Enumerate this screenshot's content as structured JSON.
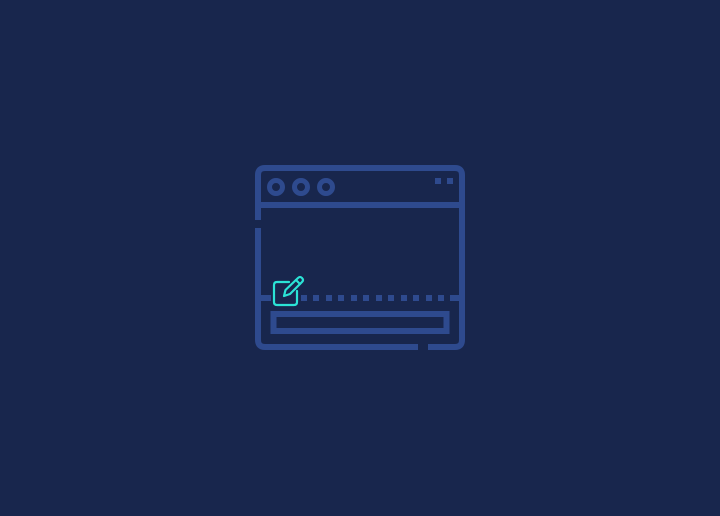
{
  "colors": {
    "background": "#18264d",
    "outline": "#2e4a8e",
    "accent": "#2be3d6"
  },
  "illustration": {
    "subject": "browser-window-with-edit-icon",
    "window_control_dots": 3,
    "dashed_separator": true,
    "bottom_bar": true
  }
}
